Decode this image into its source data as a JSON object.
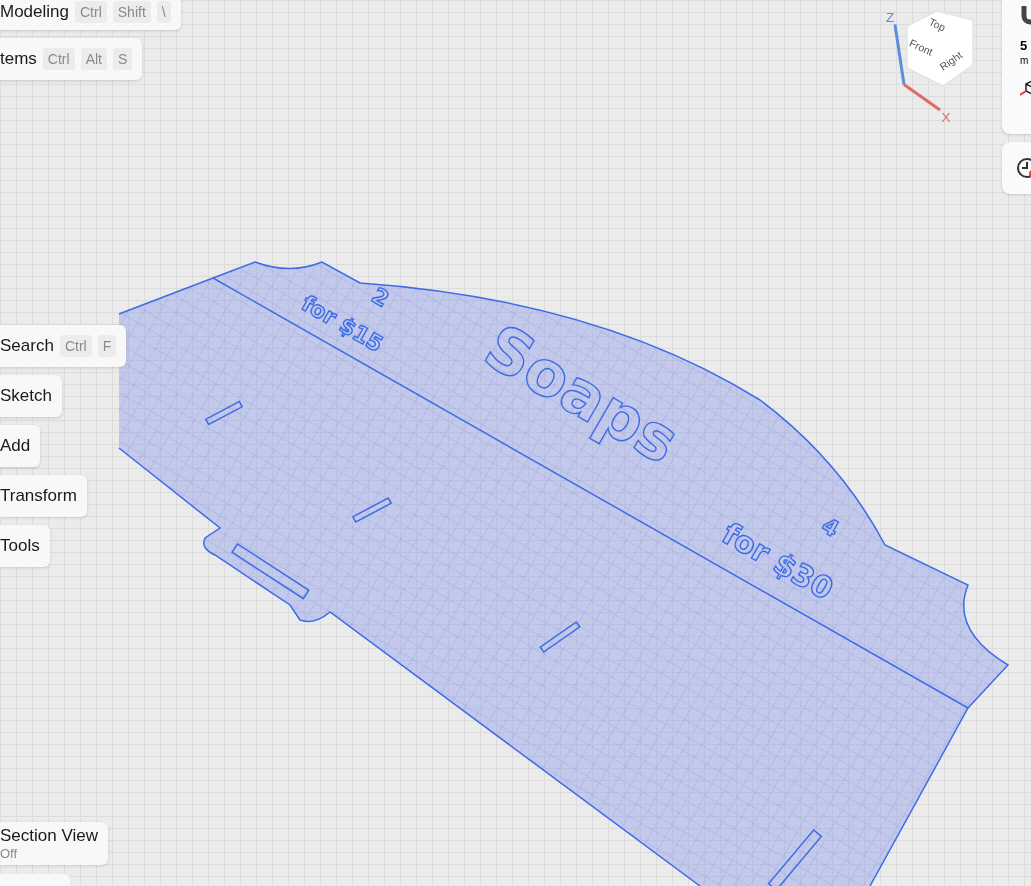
{
  "top_menus": [
    {
      "label": "Modeling",
      "keys": [
        "Ctrl",
        "Shift",
        "\\"
      ]
    },
    {
      "label": "tems",
      "keys": [
        "Ctrl",
        "Alt",
        "S"
      ]
    }
  ],
  "search": {
    "label": "Search",
    "keys": [
      "Ctrl",
      "F"
    ]
  },
  "tool_menus": [
    "Sketch",
    "Add",
    "Transform",
    "Tools"
  ],
  "section_view": {
    "label": "Section View",
    "state": "Off"
  },
  "view_cube": {
    "faces": [
      "Top",
      "Front",
      "Right"
    ],
    "axes": [
      "Z",
      "X"
    ]
  },
  "right_panel": {
    "value": "5",
    "unit": "m"
  },
  "model_texts": [
    {
      "text": "2",
      "kind": "small"
    },
    {
      "text": "for $15",
      "kind": "small"
    },
    {
      "text": "Soaps",
      "kind": "large"
    },
    {
      "text": "4",
      "kind": "small"
    },
    {
      "text": "for $30",
      "kind": "medium"
    }
  ]
}
